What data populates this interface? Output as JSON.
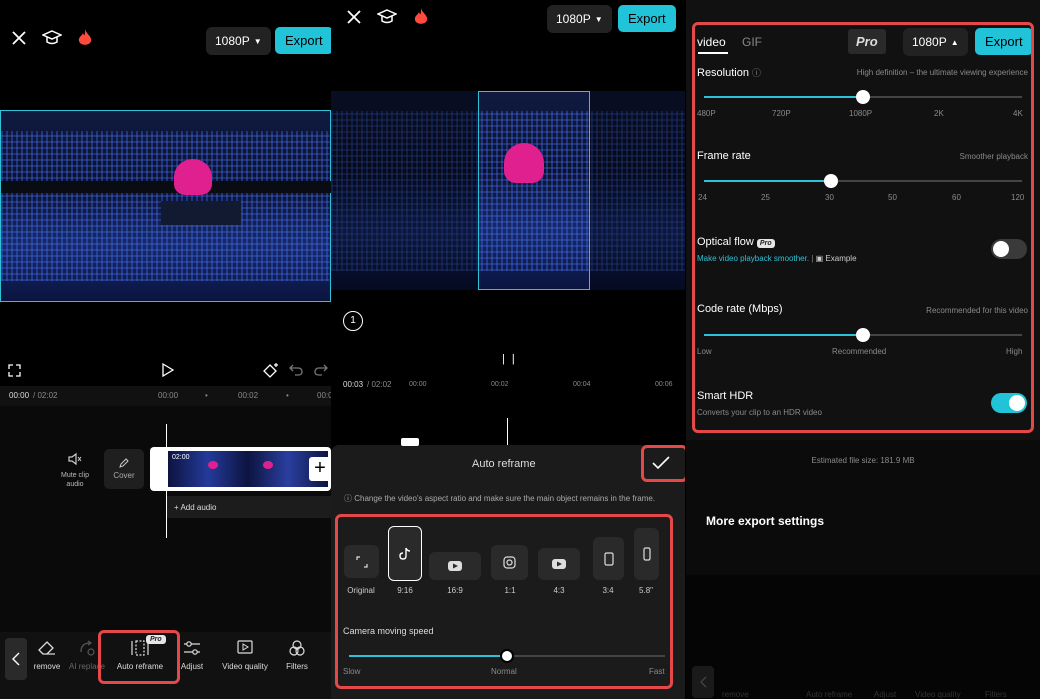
{
  "p1": {
    "resolution": "1080P",
    "export": "Export",
    "time_current": "00:00",
    "time_total": "/ 02:02",
    "ticks": [
      "00:00",
      "00:02",
      "00:0"
    ],
    "mute_label": "Mute clip audio",
    "cover_label": "Cover",
    "clip_time": "02:00",
    "add_audio": "+ Add audio",
    "tools": [
      {
        "label": "remove",
        "icon": "eraser-icon"
      },
      {
        "label": "AI replace",
        "icon": "ai-replace-icon"
      },
      {
        "label": "Auto reframe",
        "icon": "auto-reframe-icon"
      },
      {
        "label": "Adjust",
        "icon": "adjust-icon"
      },
      {
        "label": "Video quality",
        "icon": "video-quality-icon"
      },
      {
        "label": "Filters",
        "icon": "filters-icon"
      }
    ],
    "pro_badge": "Pro"
  },
  "p2": {
    "resolution": "1080P",
    "export": "Export",
    "step": "1",
    "time_current": "00:03",
    "time_total": "/ 02:02",
    "ticks": [
      "00:00",
      "00:02",
      "00:04",
      "00:06"
    ],
    "sheet_title": "Auto reframe",
    "info": "Change the video's aspect ratio and make sure the main object remains in the frame.",
    "ratios": [
      "Original",
      "9:16",
      "16:9",
      "1:1",
      "4:3",
      "3:4",
      "5.8\""
    ],
    "speed_title": "Camera moving speed",
    "speed_labels": [
      "Slow",
      "Normal",
      "Fast"
    ],
    "speed_value": 0.5
  },
  "p3": {
    "tabs": [
      "video",
      "GIF"
    ],
    "pro": "Pro",
    "resolution": "1080P",
    "export": "Export",
    "resolution_title": "Resolution",
    "resolution_hint": "High definition – the ultimate viewing experience",
    "resolution_ticks": [
      "480P",
      "720P",
      "1080P",
      "2K",
      "4K"
    ],
    "resolution_value": 0.5,
    "frame_title": "Frame rate",
    "frame_hint": "Smoother playback",
    "frame_ticks": [
      "24",
      "25",
      "30",
      "50",
      "60",
      "120"
    ],
    "frame_value": 0.4,
    "optical_title": "Optical flow",
    "optical_pro": "Pro",
    "optical_link": "Make video playback smoother.",
    "optical_example": "Example",
    "optical_on": false,
    "code_title": "Code rate (Mbps)",
    "code_hint": "Recommended for this video",
    "code_ticks": [
      "Low",
      "Recommended",
      "High"
    ],
    "code_value": 0.5,
    "hdr_title": "Smart HDR",
    "hdr_desc": "Converts your clip to an HDR video",
    "hdr_on": true,
    "file_size": "Estimated file size: 181.9 MB",
    "more": "More export settings",
    "tools_dim": [
      "remove",
      "Auto reframe",
      "Adjust",
      "Video quality",
      "Filters"
    ]
  },
  "colors": {
    "accent": "#21c3d8",
    "highlight": "#e54848",
    "pink": "#e0208f"
  }
}
